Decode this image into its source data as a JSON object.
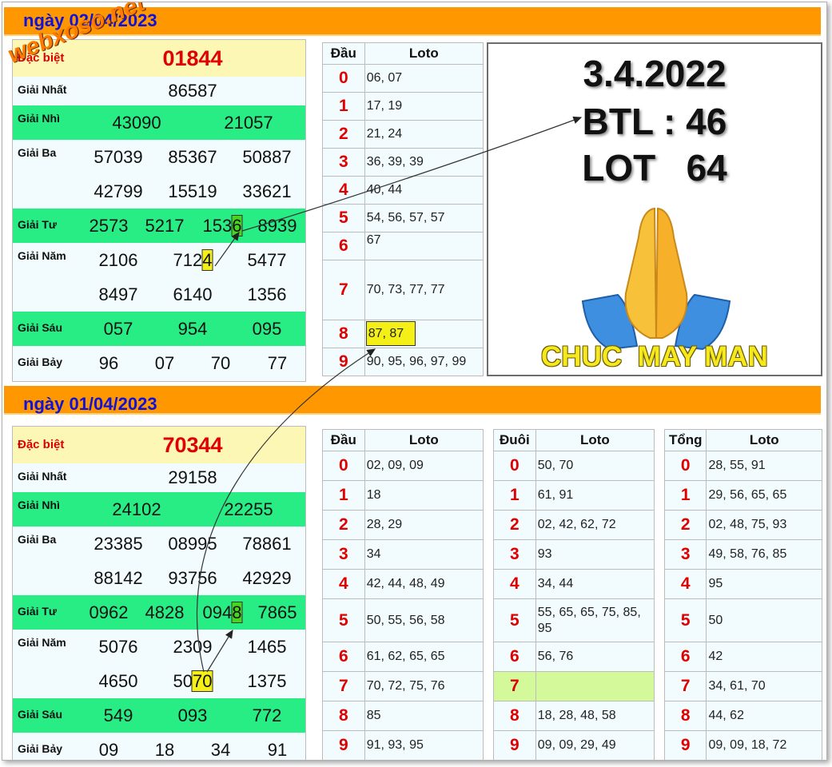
{
  "watermark": "webxoso.net",
  "colors": {
    "header_bar": "#ff9800",
    "prize_green": "#28ed85",
    "special_yellow": "#fdf7b5",
    "digit_red": "#e00000",
    "title_blue": "#1212d6"
  },
  "day1": {
    "title": "ngày 02/04/2023",
    "prizes": {
      "special": {
        "label": "Đặc biệt",
        "numbers": [
          "01844"
        ]
      },
      "first": {
        "label": "Giải Nhất",
        "numbers": [
          "86587"
        ]
      },
      "second": {
        "label": "Giải Nhì",
        "numbers": [
          "43090",
          "21057"
        ]
      },
      "third": {
        "label": "Giải Ba",
        "numbers": [
          "57039",
          "85367",
          "50887",
          "42799",
          "15519",
          "33621"
        ]
      },
      "fourth": {
        "label": "Giải Tư",
        "numbers": [
          "2573",
          "5217",
          "153",
          "6",
          "8939"
        ]
      },
      "fifth": {
        "label": "Giải Năm",
        "numbers": [
          "2106",
          "712",
          "4",
          "5477",
          "8497",
          "6140",
          "1356"
        ]
      },
      "sixth": {
        "label": "Giải Sáu",
        "numbers": [
          "057",
          "954",
          "095"
        ]
      },
      "seventh": {
        "label": "Giải Bảy",
        "numbers": [
          "96",
          "07",
          "70",
          "77"
        ]
      }
    },
    "dau_table": {
      "headers": [
        "Đầu",
        "Loto"
      ],
      "rows": [
        {
          "digit": "0",
          "loto": "06, 07"
        },
        {
          "digit": "1",
          "loto": "17, 19"
        },
        {
          "digit": "2",
          "loto": "21, 24"
        },
        {
          "digit": "3",
          "loto": "36, 39, 39"
        },
        {
          "digit": "4",
          "loto": "40, 44"
        },
        {
          "digit": "5",
          "loto": "54, 56, 57, 57"
        },
        {
          "digit": "6",
          "loto": "67"
        },
        {
          "digit": "7",
          "loto": "70, 73, 77, 77"
        },
        {
          "digit": "8",
          "loto": "87, 87"
        },
        {
          "digit": "9",
          "loto": "90, 95, 96, 97, 99"
        }
      ]
    }
  },
  "promo": {
    "date": "3.4.2022",
    "btl": "BTL : 46",
    "lot": "LOT   64",
    "icon": "praying-hands-icon",
    "footer": "CHUC  MAY MAN"
  },
  "day2": {
    "title": "ngày 01/04/2023",
    "prizes": {
      "special": {
        "label": "Đặc biệt",
        "numbers": [
          "70344"
        ]
      },
      "first": {
        "label": "Giải Nhất",
        "numbers": [
          "29158"
        ]
      },
      "second": {
        "label": "Giải Nhì",
        "numbers": [
          "24102",
          "22255"
        ]
      },
      "third": {
        "label": "Giải Ba",
        "numbers": [
          "23385",
          "08995",
          "78861",
          "88142",
          "93756",
          "42929"
        ]
      },
      "fourth": {
        "label": "Giải Tư",
        "numbers": [
          "0962",
          "4828",
          "094",
          "8",
          "7865"
        ]
      },
      "fifth": {
        "label": "Giải Năm",
        "numbers": [
          "5076",
          "2309",
          "1465",
          "4650",
          "50",
          "70",
          "1375"
        ]
      },
      "sixth": {
        "label": "Giải Sáu",
        "numbers": [
          "549",
          "093",
          "772"
        ]
      },
      "seventh": {
        "label": "Giải Bảy",
        "numbers": [
          "09",
          "18",
          "34",
          "91"
        ]
      }
    },
    "dau_table": {
      "headers": [
        "Đầu",
        "Loto"
      ],
      "rows": [
        {
          "digit": "0",
          "loto": "02, 09, 09"
        },
        {
          "digit": "1",
          "loto": "18"
        },
        {
          "digit": "2",
          "loto": "28, 29"
        },
        {
          "digit": "3",
          "loto": "34"
        },
        {
          "digit": "4",
          "loto": "42, 44, 48, 49"
        },
        {
          "digit": "5",
          "loto": "50, 55, 56, 58"
        },
        {
          "digit": "6",
          "loto": "61, 62, 65, 65"
        },
        {
          "digit": "7",
          "loto": "70, 72, 75, 76"
        },
        {
          "digit": "8",
          "loto": "85"
        },
        {
          "digit": "9",
          "loto": "91, 93, 95"
        }
      ]
    },
    "duoi_table": {
      "headers": [
        "Đuôi",
        "Loto"
      ],
      "rows": [
        {
          "digit": "0",
          "loto": "50, 70"
        },
        {
          "digit": "1",
          "loto": "61, 91"
        },
        {
          "digit": "2",
          "loto": "02, 42, 62, 72"
        },
        {
          "digit": "3",
          "loto": "93"
        },
        {
          "digit": "4",
          "loto": "34, 44"
        },
        {
          "digit": "5",
          "loto": "55, 65, 65, 75, 85, 95"
        },
        {
          "digit": "6",
          "loto": "56, 76"
        },
        {
          "digit": "7",
          "loto": ""
        },
        {
          "digit": "8",
          "loto": "18, 28, 48, 58"
        },
        {
          "digit": "9",
          "loto": "09, 09, 29, 49"
        }
      ]
    },
    "tong_table": {
      "headers": [
        "Tổng",
        "Loto"
      ],
      "rows": [
        {
          "digit": "0",
          "loto": "28, 55, 91"
        },
        {
          "digit": "1",
          "loto": "29, 56, 65, 65"
        },
        {
          "digit": "2",
          "loto": "02, 48, 75, 93"
        },
        {
          "digit": "3",
          "loto": "49, 58, 76, 85"
        },
        {
          "digit": "4",
          "loto": "95"
        },
        {
          "digit": "5",
          "loto": "50"
        },
        {
          "digit": "6",
          "loto": "42"
        },
        {
          "digit": "7",
          "loto": "34, 61, 70"
        },
        {
          "digit": "8",
          "loto": "44, 62"
        },
        {
          "digit": "9",
          "loto": "09, 09, 18, 72"
        }
      ]
    }
  }
}
